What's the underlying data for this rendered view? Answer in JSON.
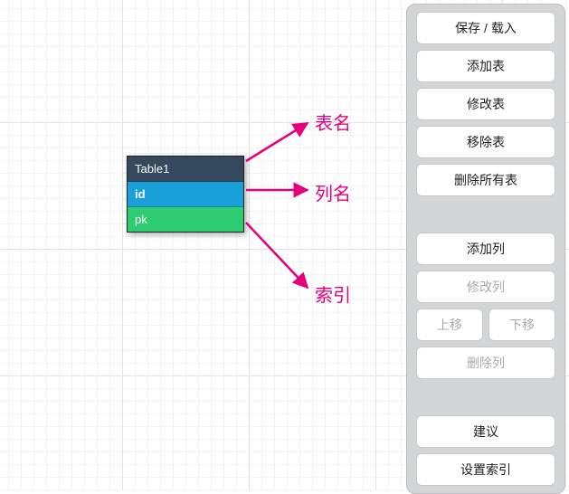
{
  "table": {
    "name": "Table1",
    "column": "id",
    "index": "pk"
  },
  "annotations": {
    "table_name": "表名",
    "column_name": "列名",
    "index_name": "索引"
  },
  "toolbar": {
    "save_load": "保存 / 载入",
    "add_table": "添加表",
    "edit_table": "修改表",
    "remove_table": "移除表",
    "remove_all_tables": "删除所有表",
    "add_column": "添加列",
    "edit_column": "修改列",
    "move_up": "上移",
    "move_down": "下移",
    "delete_column": "删除列",
    "suggest": "建议",
    "set_index": "设置索引"
  },
  "colors": {
    "arrow": "#e6007e",
    "table_header": "#34495e",
    "table_column": "#1aa0d8",
    "table_index": "#2ecc71"
  }
}
